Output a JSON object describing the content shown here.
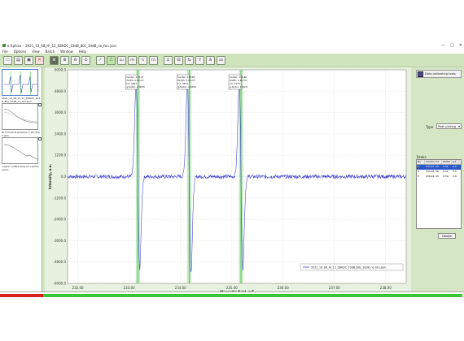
{
  "window": {
    "title": "e-Sphinx – 2021_10_08_Hi_12_08ADC_10dB_80s_10dB_no_fan.json",
    "controls": [
      "—",
      "□",
      "✕"
    ]
  },
  "menu": [
    "File",
    "Options",
    "View",
    "Batch",
    "Window",
    "Help"
  ],
  "toolbar": {
    "buttons": [
      {
        "name": "new-icon",
        "glyph": "▭"
      },
      {
        "name": "open-icon",
        "glyph": "▤"
      },
      {
        "name": "save-icon",
        "glyph": "▣"
      },
      {
        "name": "delete-icon",
        "glyph": "✕"
      },
      {
        "name": "gear-icon",
        "glyph": "⚙"
      },
      {
        "name": "zoom-in-icon",
        "glyph": "⊕"
      },
      {
        "name": "zoom-out-icon",
        "glyph": "⊖"
      },
      {
        "name": "zoom-fit-icon",
        "glyph": "⊙"
      },
      {
        "name": "check-icon",
        "glyph": "✓"
      },
      {
        "name": "peak-icon",
        "glyph": "⎍"
      },
      {
        "name": "mode-auto-icon",
        "glyph": "AU"
      },
      {
        "name": "mode-filter-icon",
        "glyph": "FM"
      },
      {
        "name": "wave-icon",
        "glyph": "∿"
      },
      {
        "name": "fit-icon",
        "glyph": "FIT"
      },
      {
        "name": "sample-icon",
        "glyph": "♙"
      },
      {
        "name": "lock-icon",
        "glyph": "⊟"
      },
      {
        "name": "compare-icon",
        "glyph": "⇆"
      },
      {
        "name": "export-icon",
        "glyph": "⇪"
      },
      {
        "name": "align-icon",
        "glyph": "⋔"
      },
      {
        "name": "ab-icon",
        "glyph": "AB"
      }
    ]
  },
  "thumbnails": [
    {
      "caption": "2021_10_08_Hi_12_08ADC_10dB_80s_10dB_no_fan.json",
      "selected": true
    },
    {
      "caption": "Ni-tl CrO2 B-ampoule 1 sib-1700.json",
      "selected": false
    },
    {
      "caption": "copper sulfate-amp 07 capillary.json",
      "selected": false
    }
  ],
  "right_panel": {
    "tool_label": "Data calibrating tools",
    "type_label": "Type",
    "type_value": "Peak picking",
    "peaks_title": "Peaks",
    "columns": [
      "No",
      "Center",
      "Int",
      "Width",
      "g-F"
    ],
    "rows": [
      [
        "1",
        "233.47",
        "40",
        "0.50",
        "2.0"
      ],
      [
        "2",
        "234.95",
        "36",
        "0.50",
        "2.0"
      ],
      [
        "3",
        "236.46",
        "43",
        "0.50",
        "2.0"
      ]
    ],
    "delete_button": "Delete"
  },
  "chart_data": {
    "type": "line",
    "title": "",
    "xlabel": "Magnetic field, mT",
    "ylabel": "Intensity, a.u.",
    "xlim": [
      231.8,
      238.4
    ],
    "ylim": [
      -6000,
      6000
    ],
    "xticks": [
      232.0,
      233.0,
      234.0,
      235.0,
      236.0,
      237.0,
      238.0
    ],
    "xtick_labels": [
      "232.00",
      "233.00",
      "234.00",
      "235.00",
      "236.00",
      "237.00",
      "238.00"
    ],
    "yticks": [
      6000,
      4800,
      3600,
      2400,
      1200,
      0,
      -1200,
      -2400,
      -3600,
      -4800,
      -6000
    ],
    "ytick_labels": [
      "6000.0",
      "4800.0",
      "3600.0",
      "2400.0",
      "1200.0",
      "0.0",
      "-1200.0",
      "-2400.0",
      "-3600.0",
      "-4800.0",
      "-6000.0"
    ],
    "grid": true,
    "legend": {
      "position": "bottom-right",
      "label": "2021_10_08_Hi_12_08ADC_10dB_80s_10dB_no_fan.json"
    },
    "series": [
      {
        "color": "#3b3bd0",
        "lines": [
          {
            "center": 233.17,
            "amplitude": 5200,
            "width": 0.05
          },
          {
            "center": 234.17,
            "amplitude": 5400,
            "width": 0.05
          },
          {
            "center": 235.18,
            "amplitude": 5200,
            "width": 0.05
          }
        ],
        "noise": 110
      }
    ],
    "markers": [
      {
        "x": 233.17,
        "color": "#3ec03e",
        "label": [
          "Center: 233.47",
          "Width: 0.10 mT",
          "Int: 4094",
          "g-factor: 2.0030"
        ]
      },
      {
        "x": 234.17,
        "color": "#3ec03e",
        "label": [
          "Center: 234.95",
          "Width: 0.10 mT",
          "Int: 3873",
          "g-factor: 2.0016"
        ]
      },
      {
        "x": 235.18,
        "color": "#3ec03e",
        "label": [
          "Center: 236.46",
          "Width: 0.10 mT",
          "Int: 4475",
          "g-factor: 1.9971"
        ]
      }
    ]
  }
}
